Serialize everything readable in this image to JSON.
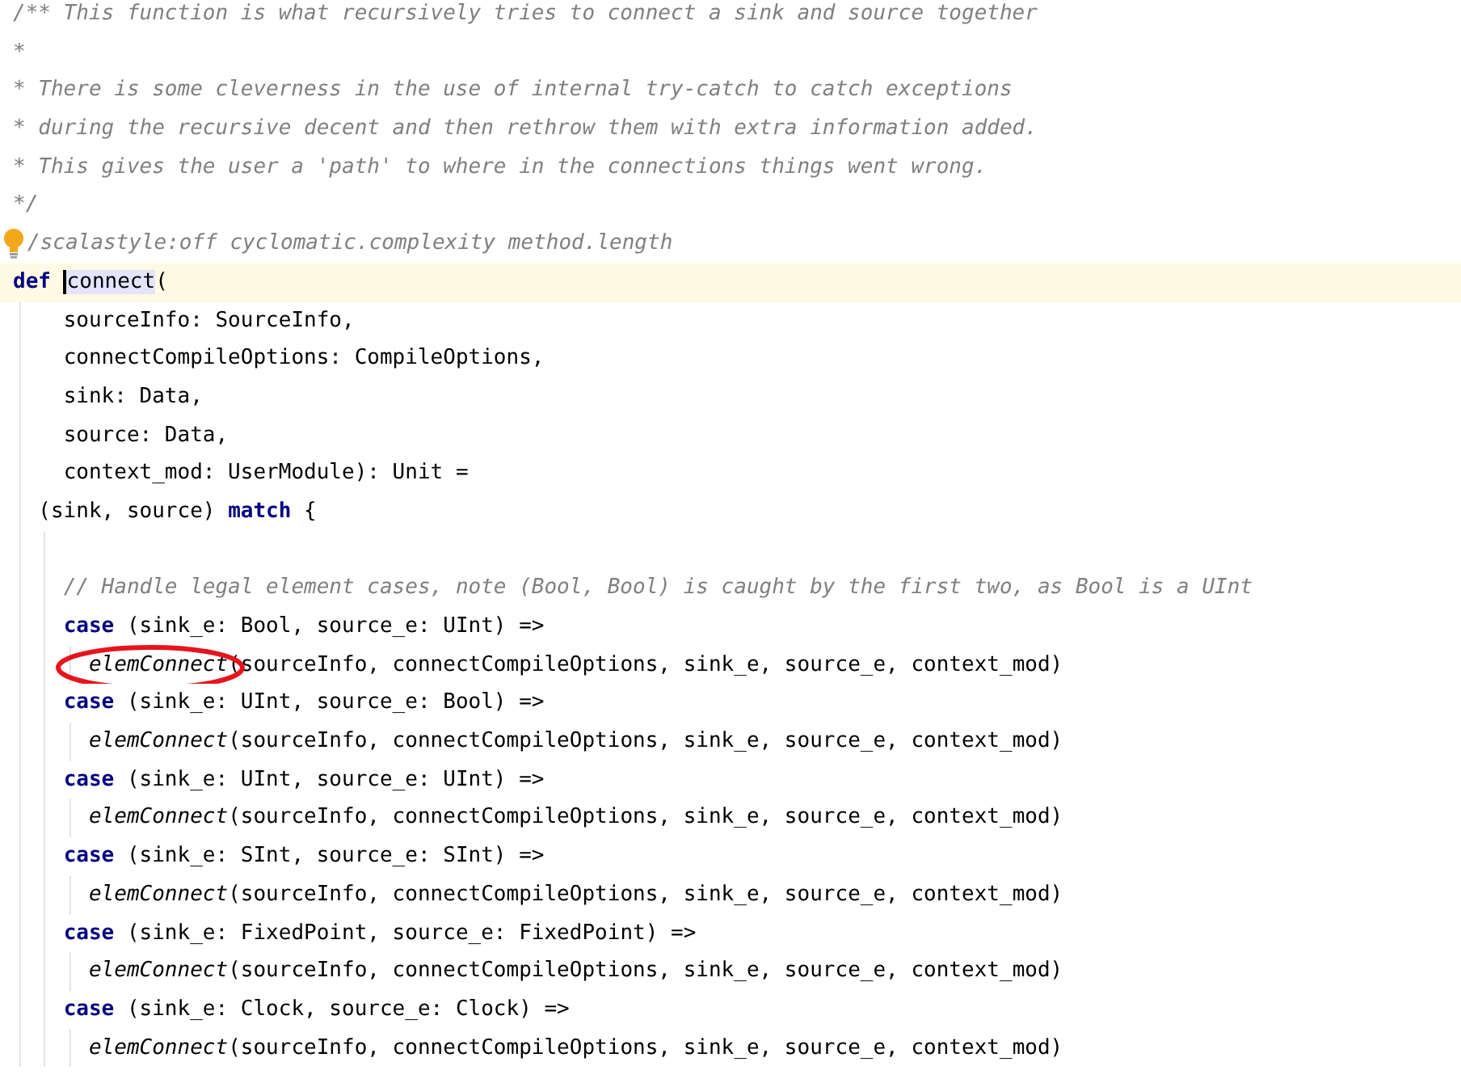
{
  "editor": {
    "lines": [
      {
        "kind": "comment",
        "tokens": [
          {
            "kind": "comment",
            "text": "/** This function is what recursively tries to connect a sink and source together"
          }
        ]
      },
      {
        "kind": "comment",
        "tokens": [
          {
            "kind": "comment",
            "text": "*"
          }
        ]
      },
      {
        "kind": "comment",
        "tokens": [
          {
            "kind": "comment",
            "text": "* There is some cleverness in the use of internal try-catch to catch exceptions"
          }
        ]
      },
      {
        "kind": "comment",
        "tokens": [
          {
            "kind": "comment",
            "text": "* during the recursive decent and then rethrow them with extra information added."
          }
        ]
      },
      {
        "kind": "comment",
        "tokens": [
          {
            "kind": "comment",
            "text": "* This gives the user a 'path' to where in the connections things went wrong."
          }
        ]
      },
      {
        "kind": "comment",
        "tokens": [
          {
            "kind": "comment",
            "text": "*/"
          }
        ]
      },
      {
        "kind": "comment",
        "bulb": true,
        "tokens": [
          {
            "kind": "comment",
            "text": "/scalastyle:off cyclomatic.complexity method.length"
          }
        ]
      },
      {
        "kind": "def",
        "current": true,
        "tokens": [
          {
            "kind": "keyword",
            "text": "def"
          },
          {
            "kind": "highlight",
            "text": "connect"
          },
          {
            "kind": "plain",
            "text": "("
          }
        ]
      },
      {
        "kind": "param",
        "tokens": [
          {
            "kind": "plain",
            "text": "sourceInfo: SourceInfo,"
          }
        ]
      },
      {
        "kind": "param",
        "tokens": [
          {
            "kind": "plain",
            "text": "connectCompileOptions: CompileOptions,"
          }
        ]
      },
      {
        "kind": "param",
        "tokens": [
          {
            "kind": "plain",
            "text": "sink: Data,"
          }
        ]
      },
      {
        "kind": "param",
        "tokens": [
          {
            "kind": "plain",
            "text": "source: Data,"
          }
        ]
      },
      {
        "kind": "param",
        "tokens": [
          {
            "kind": "plain",
            "text": "context_mod: UserModule): Unit ="
          }
        ]
      },
      {
        "kind": "match",
        "tokens": [
          {
            "kind": "plain",
            "text": "(sink, source) "
          },
          {
            "kind": "keyword",
            "text": "match"
          },
          {
            "kind": "plain",
            "text": " {"
          }
        ]
      },
      {
        "kind": "blank"
      },
      {
        "kind": "case",
        "tokens": [
          {
            "kind": "comment",
            "text": "// Handle legal element cases, note (Bool, Bool) is caught by the first two, as Bool is a UInt"
          }
        ]
      },
      {
        "kind": "case",
        "tokens": [
          {
            "kind": "keyword",
            "text": "case"
          },
          {
            "kind": "plain",
            "text": " (sink_e: Bool, source_e: UInt) =>"
          }
        ]
      },
      {
        "kind": "call",
        "circled": true,
        "tokens": [
          {
            "kind": "call",
            "text": "elemConnect"
          },
          {
            "kind": "plain",
            "text": "(sourceInfo, connectCompileOptions, sink_e, source_e, context_mod)"
          }
        ]
      },
      {
        "kind": "case",
        "tokens": [
          {
            "kind": "keyword",
            "text": "case"
          },
          {
            "kind": "plain",
            "text": " (sink_e: UInt, source_e: Bool) =>"
          }
        ]
      },
      {
        "kind": "call",
        "tokens": [
          {
            "kind": "call",
            "text": "elemConnect"
          },
          {
            "kind": "plain",
            "text": "(sourceInfo, connectCompileOptions, sink_e, source_e, context_mod)"
          }
        ]
      },
      {
        "kind": "case",
        "tokens": [
          {
            "kind": "keyword",
            "text": "case"
          },
          {
            "kind": "plain",
            "text": " (sink_e: UInt, source_e: UInt) =>"
          }
        ]
      },
      {
        "kind": "call",
        "tokens": [
          {
            "kind": "call",
            "text": "elemConnect"
          },
          {
            "kind": "plain",
            "text": "(sourceInfo, connectCompileOptions, sink_e, source_e, context_mod)"
          }
        ]
      },
      {
        "kind": "case",
        "tokens": [
          {
            "kind": "keyword",
            "text": "case"
          },
          {
            "kind": "plain",
            "text": " (sink_e: SInt, source_e: SInt) =>"
          }
        ]
      },
      {
        "kind": "call",
        "tokens": [
          {
            "kind": "call",
            "text": "elemConnect"
          },
          {
            "kind": "plain",
            "text": "(sourceInfo, connectCompileOptions, sink_e, source_e, context_mod)"
          }
        ]
      },
      {
        "kind": "case",
        "tokens": [
          {
            "kind": "keyword",
            "text": "case"
          },
          {
            "kind": "plain",
            "text": " (sink_e: FixedPoint, source_e: FixedPoint) =>"
          }
        ]
      },
      {
        "kind": "call",
        "tokens": [
          {
            "kind": "call",
            "text": "elemConnect"
          },
          {
            "kind": "plain",
            "text": "(sourceInfo, connectCompileOptions, sink_e, source_e, context_mod)"
          }
        ]
      },
      {
        "kind": "case",
        "tokens": [
          {
            "kind": "keyword",
            "text": "case"
          },
          {
            "kind": "plain",
            "text": " (sink_e: Clock, source_e: Clock) =>"
          }
        ]
      },
      {
        "kind": "call",
        "tokens": [
          {
            "kind": "call",
            "text": "elemConnect"
          },
          {
            "kind": "plain",
            "text": "(sourceInfo, connectCompileOptions, sink_e, source_e, context_mod)"
          }
        ]
      }
    ]
  }
}
